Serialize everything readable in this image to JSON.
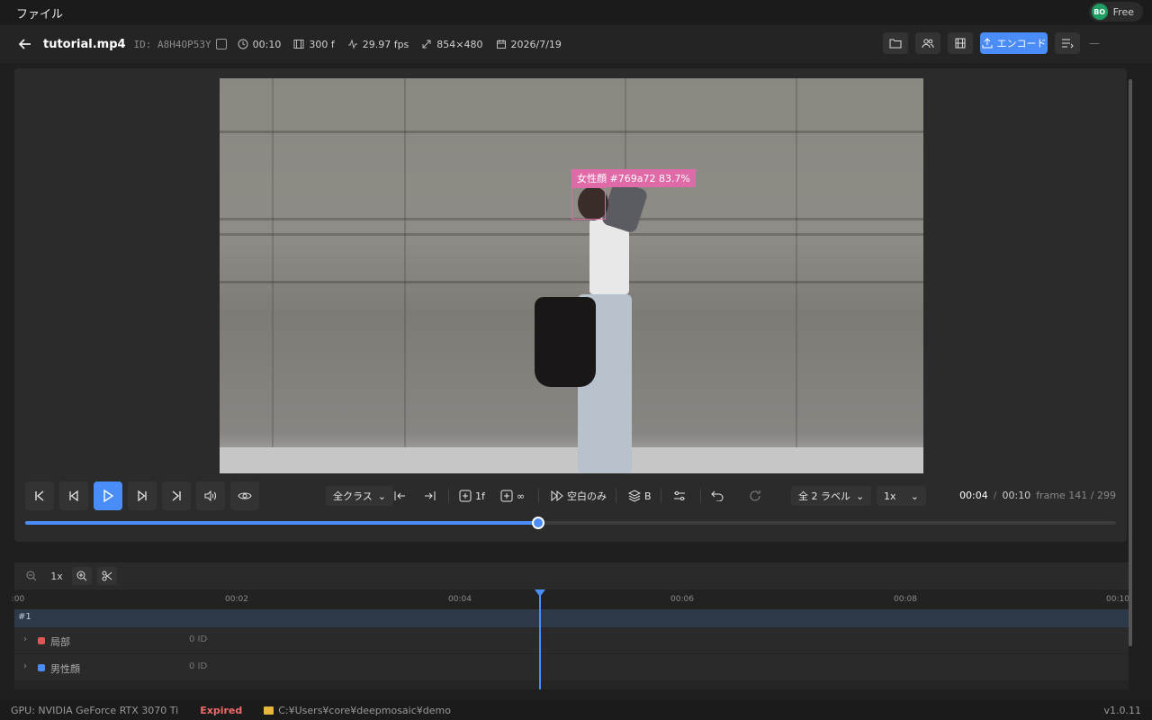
{
  "menu": {
    "file": "ファイル"
  },
  "account": {
    "avatar_initials": "BO",
    "plan": "Free"
  },
  "header": {
    "filename": "tutorial.mp4",
    "id_label": "ID: A8H4OP53Y",
    "duration": "00:10",
    "frames": "300 f",
    "fps": "29.97 fps",
    "resolution": "854×480",
    "date": "2026/7/19",
    "encode_label": "エンコード"
  },
  "video": {
    "detection_label": "女性顔 #769a72 83.7%",
    "detection_color": "#e06aa7"
  },
  "controls": {
    "class_filter": "全クラス",
    "add_frame": "1f",
    "add_infinite": "∞",
    "blank_only": "空白のみ",
    "layer_label": "B",
    "label_filter": "全 2 ラベル",
    "speed": "1x",
    "current_time": "00:04",
    "total_time": "00:10",
    "frame_info": "frame 141 / 299",
    "progress": 0.47
  },
  "timeline": {
    "zoom": "1x",
    "ticks": [
      ":00",
      "00:02",
      "00:04",
      "00:06",
      "00:08",
      "00:10"
    ],
    "track_name": "#1",
    "rows": [
      {
        "name": "局部",
        "count": "0 ID",
        "color": "#e05555"
      },
      {
        "name": "男性顔",
        "count": "0 ID",
        "color": "#4b8df8"
      }
    ]
  },
  "status": {
    "gpu": "GPU: NVIDIA GeForce RTX 3070 Ti",
    "license": "Expired",
    "path": "C:¥Users¥core¥deepmosaic¥demo",
    "version": "v1.0.11"
  },
  "colors": {
    "accent": "#4b8df8",
    "expired": "#f06a6a"
  }
}
